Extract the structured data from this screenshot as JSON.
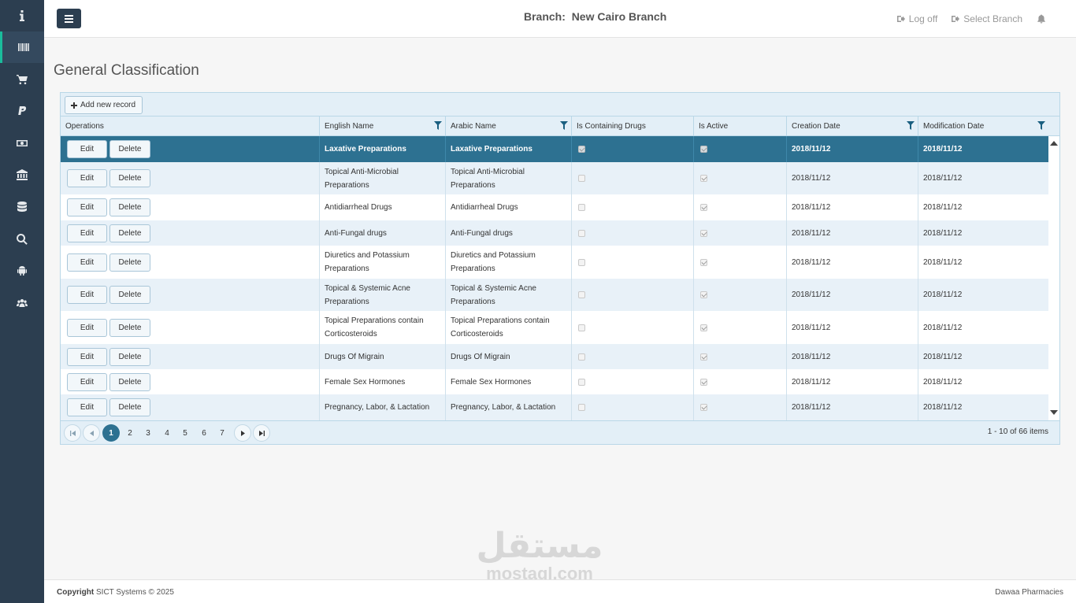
{
  "sidebar": {
    "items": [
      {
        "icon": "info-icon"
      },
      {
        "icon": "barcode-icon",
        "active": true
      },
      {
        "icon": "cart-icon"
      },
      {
        "icon": "paypal-icon"
      },
      {
        "icon": "money-icon"
      },
      {
        "icon": "bank-icon"
      },
      {
        "icon": "database-icon"
      },
      {
        "icon": "search-icon"
      },
      {
        "icon": "android-icon"
      },
      {
        "icon": "users-icon"
      }
    ]
  },
  "header": {
    "branch_label": "Branch:",
    "branch_name": "New Cairo Branch",
    "log_off": "Log off",
    "select_branch": "Select Branch"
  },
  "page": {
    "title": "General Classification"
  },
  "grid": {
    "add_label": "Add new record",
    "columns": [
      "Operations",
      "English Name",
      "Arabic Name",
      "Is Containing Drugs",
      "Is Active",
      "Creation Date",
      "Modification Date"
    ],
    "edit_label": "Edit",
    "delete_label": "Delete",
    "rows": [
      {
        "english": "Laxative Preparations",
        "arabic": "Laxative Preparations",
        "containing": true,
        "active": true,
        "created": "2018/11/12",
        "modified": "2018/11/12",
        "selected": true
      },
      {
        "english": "Topical Anti-Microbial Preparations",
        "arabic": "Topical Anti-Microbial Preparations",
        "containing": false,
        "active": true,
        "created": "2018/11/12",
        "modified": "2018/11/12"
      },
      {
        "english": "Antidiarrheal Drugs",
        "arabic": "Antidiarrheal Drugs",
        "containing": false,
        "active": true,
        "created": "2018/11/12",
        "modified": "2018/11/12"
      },
      {
        "english": "Anti-Fungal drugs",
        "arabic": "Anti-Fungal drugs",
        "containing": false,
        "active": true,
        "created": "2018/11/12",
        "modified": "2018/11/12"
      },
      {
        "english": "Diuretics and Potassium Preparations",
        "arabic": "Diuretics and Potassium Preparations",
        "containing": false,
        "active": true,
        "created": "2018/11/12",
        "modified": "2018/11/12"
      },
      {
        "english": "Topical & Systemic Acne Preparations",
        "arabic": "Topical & Systemic Acne Preparations",
        "containing": false,
        "active": true,
        "created": "2018/11/12",
        "modified": "2018/11/12"
      },
      {
        "english": "Topical Preparations contain Corticosteroids",
        "arabic": "Topical Preparations contain Corticosteroids",
        "containing": false,
        "active": true,
        "created": "2018/11/12",
        "modified": "2018/11/12"
      },
      {
        "english": "Drugs Of Migrain",
        "arabic": "Drugs Of Migrain",
        "containing": false,
        "active": true,
        "created": "2018/11/12",
        "modified": "2018/11/12"
      },
      {
        "english": "Female Sex Hormones",
        "arabic": "Female Sex Hormones",
        "containing": false,
        "active": true,
        "created": "2018/11/12",
        "modified": "2018/11/12"
      },
      {
        "english": "Pregnancy, Labor, & Lactation",
        "arabic": "Pregnancy, Labor, & Lactation",
        "containing": false,
        "active": true,
        "created": "2018/11/12",
        "modified": "2018/11/12"
      }
    ]
  },
  "pager": {
    "pages": [
      "1",
      "2",
      "3",
      "4",
      "5",
      "6",
      "7"
    ],
    "current": "1",
    "info": "1 - 10 of 66 items"
  },
  "footer": {
    "copyright_bold": "Copyright",
    "copyright_rest": " SICT Systems © 2025",
    "right": "Dawaa Pharmacies"
  },
  "watermark": {
    "arabic": "مستقل",
    "latin": "mostaql.com"
  },
  "colors": {
    "sidebar": "#2c3e50",
    "accent": "#1abc9c",
    "selected_row": "#2d7191",
    "grid_header": "#e3eff7"
  }
}
